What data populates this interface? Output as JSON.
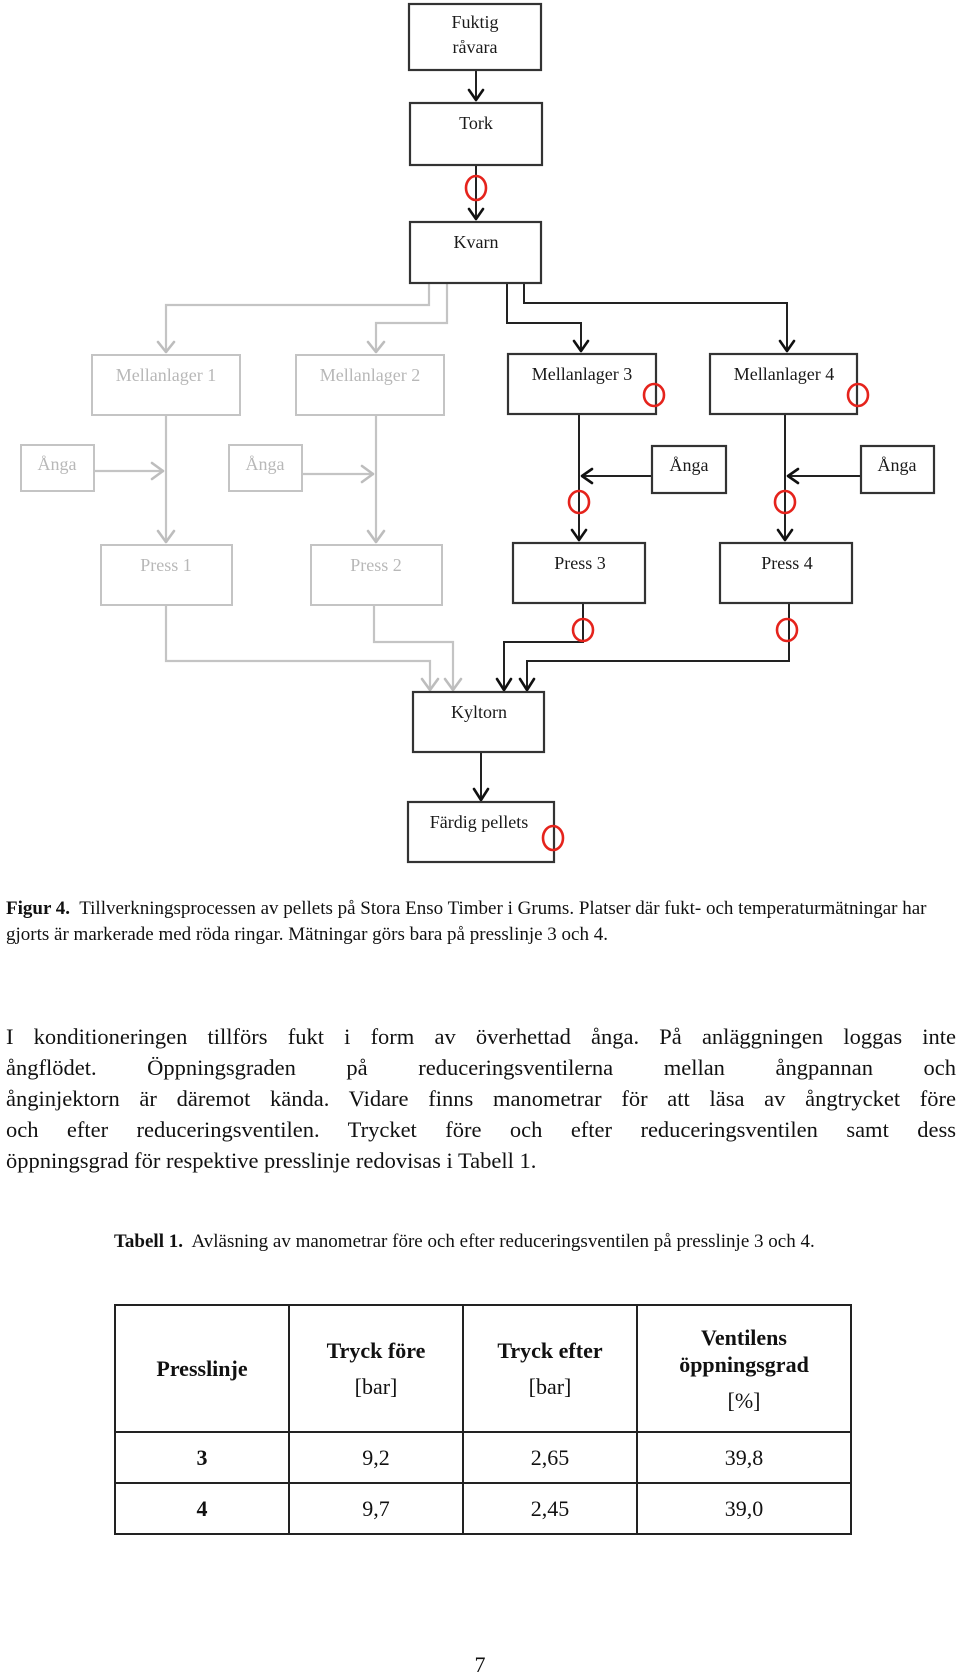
{
  "figure": {
    "nodes": {
      "fuktig_ravara": [
        "Fuktig",
        "råvara"
      ],
      "tork": "Tork",
      "kvarn": "Kvarn",
      "mellanlager_1": "Mellanlager 1",
      "mellanlager_2": "Mellanlager 2",
      "mellanlager_3": "Mellanlager 3",
      "mellanlager_4": "Mellanlager 4",
      "anga_1": "Ånga",
      "anga_2": "Ånga",
      "anga_3": "Ånga",
      "anga_4": "Ånga",
      "press_1": "Press 1",
      "press_2": "Press 2",
      "press_3": "Press 3",
      "press_4": "Press 4",
      "kyltorn": "Kyltorn",
      "fardig_pellets": "Färdig pellets"
    },
    "inactive_lines": [
      "1",
      "2"
    ],
    "active_lines": [
      "3",
      "4"
    ],
    "colors": {
      "active": "#222222",
      "inactive": "#c4c4c4",
      "measurement_ring": "#e5231c"
    },
    "caption_label": "Figur 4.",
    "caption_text": "Tillverkningsprocessen av pellets på Stora Enso Timber i Grums. Platser där fukt- och temperaturmätningar har gjorts är markerade med röda ringar. Mätningar görs bara på presslinje 3 och 4."
  },
  "paragraph": {
    "lines": [
      "I konditioneringen tillförs fukt i form av överhettad ånga. På anläggningen loggas inte",
      "ångflödet. Öppningsgraden på reduceringsventilerna mellan ångpannan och",
      "ånginjektorn är däremot kända. Vidare finns manometrar för att läsa av ångtrycket före",
      "och efter reduceringsventilen. Trycket före och efter reduceringsventilen samt dess",
      "öppningsgrad för respektive presslinje redovisas i Tabell 1."
    ]
  },
  "table": {
    "caption_label": "Tabell 1.",
    "caption_text": "Avläsning av manometrar före och efter reduceringsventilen på presslinje 3 och 4.",
    "headers": [
      {
        "title": "Presslinje",
        "unit": ""
      },
      {
        "title": "Tryck före",
        "unit": "[bar]"
      },
      {
        "title": "Tryck efter",
        "unit": "[bar]"
      },
      {
        "title": "Ventilens öppningsgrad",
        "unit": "[%]"
      }
    ],
    "rows": [
      [
        "3",
        "9,2",
        "2,65",
        "39,8"
      ],
      [
        "4",
        "9,7",
        "2,45",
        "39,0"
      ]
    ]
  },
  "page_number": "7"
}
